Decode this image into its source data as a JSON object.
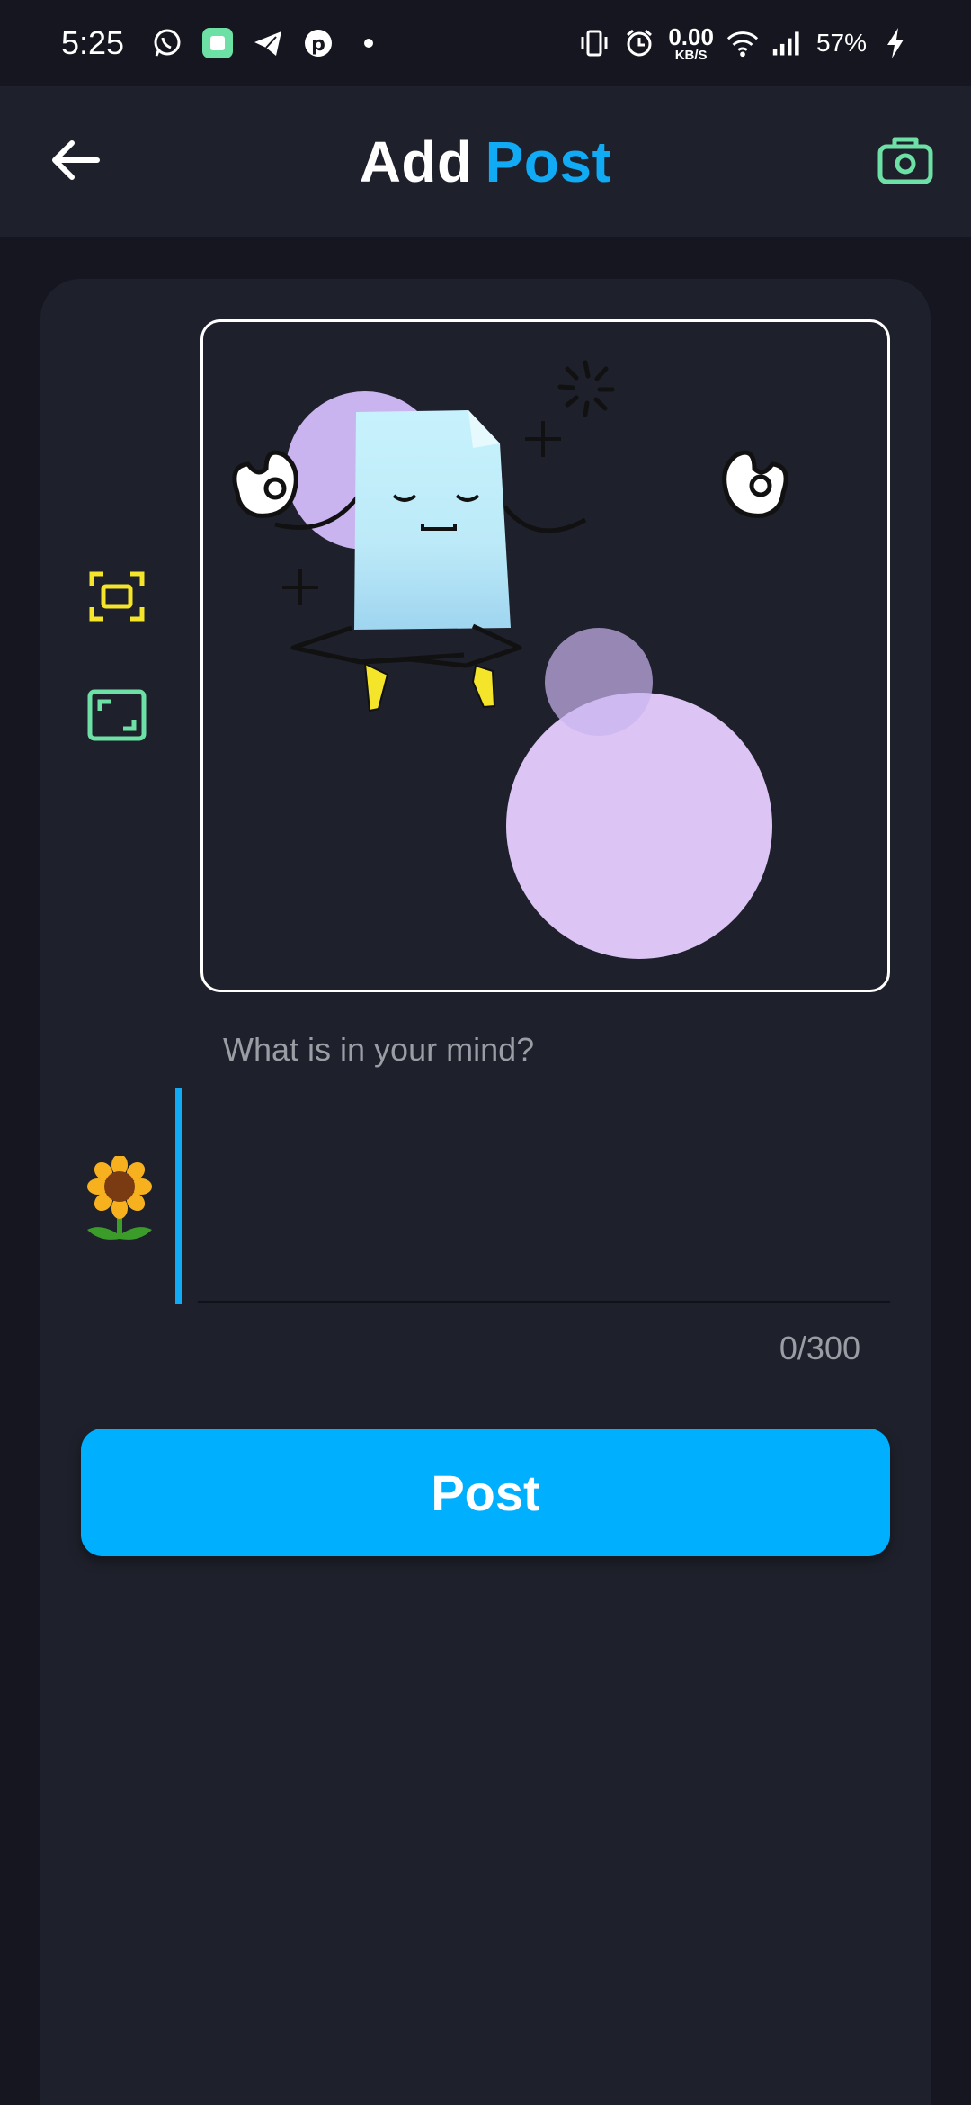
{
  "status_bar": {
    "time": "5:25",
    "net_speed_value": "0.00",
    "net_speed_unit": "KB/S",
    "battery": "57%",
    "notification_icons": [
      "whatsapp-icon",
      "app-square-icon",
      "telegram-icon",
      "pinterest-icon",
      "dot-icon"
    ],
    "system_icons": [
      "vibrate-icon",
      "alarm-icon",
      "wifi-icon",
      "signal-icon",
      "charging-icon"
    ]
  },
  "app_bar": {
    "title_part1": "Add",
    "title_part2": "Post",
    "back_icon": "arrow-left-icon",
    "action_icon": "camera-icon"
  },
  "editor": {
    "tools": [
      "crop-frame-icon",
      "aspect-ratio-icon"
    ],
    "placeholder": "What is in your mind?",
    "emoji": "🌻",
    "text": "",
    "counter": "0/300"
  },
  "post_button": {
    "label": "Post"
  },
  "colors": {
    "accent": "#10aaf5",
    "button": "#00b0ff",
    "tool_yellow": "#f5e52a",
    "tool_green": "#6de0a6",
    "card": "#1e202b",
    "background": "#15161f"
  }
}
